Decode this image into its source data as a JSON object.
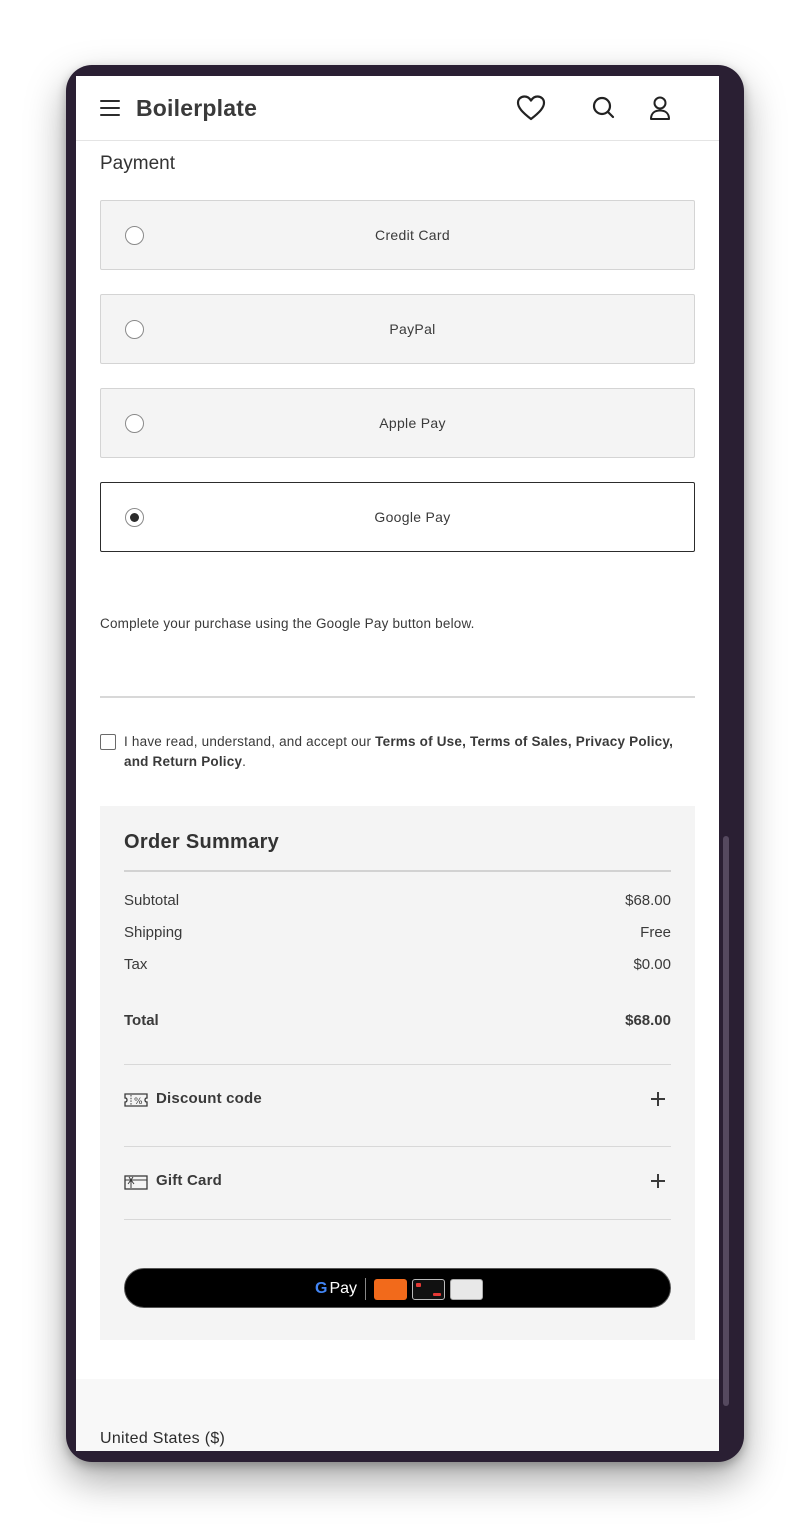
{
  "header": {
    "brand": "Boilerplate",
    "icons": [
      "menu-icon",
      "heart-icon",
      "search-icon",
      "user-icon"
    ]
  },
  "payment": {
    "title": "Payment",
    "options": [
      {
        "label": "Credit Card",
        "selected": false
      },
      {
        "label": "PayPal",
        "selected": false
      },
      {
        "label": "Apple Pay",
        "selected": false
      },
      {
        "label": "Google Pay",
        "selected": true
      }
    ],
    "note": "Complete your purchase using the Google Pay button below."
  },
  "terms": {
    "prefix": "I have read, understand, and accept our ",
    "links": "Terms of Use, Terms of Sales, Privacy Policy, and Return Policy",
    "suffix": ".",
    "checked": false
  },
  "summary": {
    "title": "Order Summary",
    "rows": [
      {
        "label": "Subtotal",
        "value": "$68.00"
      },
      {
        "label": "Shipping",
        "value": "Free"
      },
      {
        "label": "Tax",
        "value": "$0.00"
      }
    ],
    "total": {
      "label": "Total",
      "value": "$68.00"
    },
    "discount_label": "Discount code",
    "gift_label": "Gift Card",
    "gpay_button": {
      "g": "G",
      "pay": "Pay"
    }
  },
  "footer": {
    "region": "United States ($)"
  },
  "colors": {
    "device_frame": "#2a1f33",
    "selected_border": "#2c2c2c",
    "option_bg": "#f4f4f4",
    "gpay_button_bg": "#000000"
  }
}
